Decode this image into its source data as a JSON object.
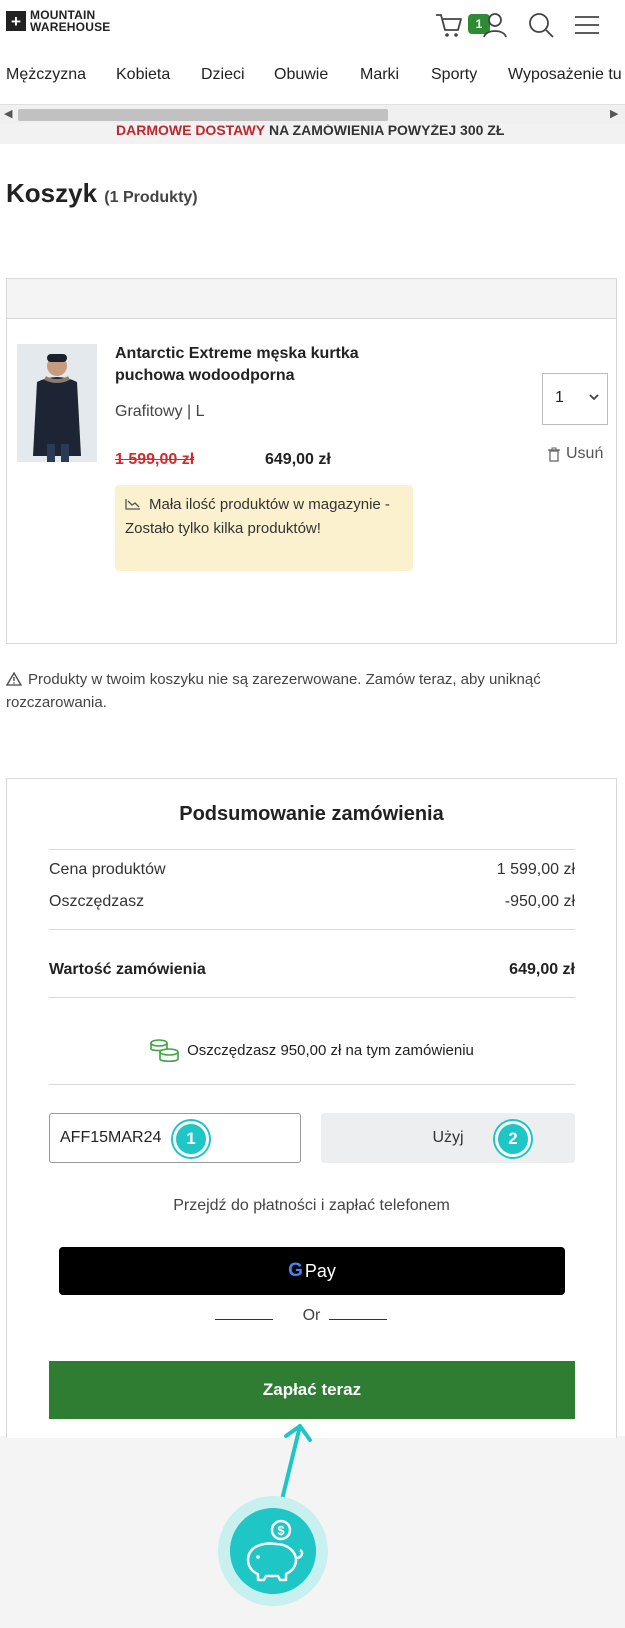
{
  "brand": {
    "line1": "MOUNTAIN",
    "line2": "WAREHOUSE",
    "mark": "+"
  },
  "header": {
    "cart_count": "1"
  },
  "nav": {
    "items": [
      "Mężczyzna",
      "Kobieta",
      "Dzieci",
      "Obuwie",
      "Marki",
      "Sporty",
      "Wyposażenie tu"
    ]
  },
  "promo": {
    "text_red": "DARMOWE DOSTAWY",
    "text_dark": " NA ZAMÓWIENIA POWYŻEJ 300 ZŁ"
  },
  "page": {
    "title": "Koszyk",
    "count": "(1 Produkty)"
  },
  "basket": {
    "item": {
      "name": "Antarctic Extreme męska kurtka puchowa wodoodporna",
      "variant": "Grafitowy | L",
      "price_old": "1 599,00 zł",
      "price_new": "649,00 zł",
      "qty": "1",
      "remove": "Usuń",
      "stock_note": "Mała ilość produktów w magazynie - Zostało tylko kilka produktów!"
    }
  },
  "warning": "Produkty w twoim koszyku nie są zarezerwowane. Zamów teraz, aby uniknąć rozczarowania.",
  "summary": {
    "title": "Podsumowanie zamówienia",
    "rows": [
      {
        "label": "Cena produktów",
        "value": "1 599,00 zł"
      },
      {
        "label": "Oszczędzasz",
        "value": "-950,00 zł"
      }
    ],
    "total_label": "Wartość zamówienia",
    "total_value": "649,00 zł",
    "saving_text": "Oszczędzasz 950,00 zł na tym zamówieniu",
    "code_value": "AFF15MAR24",
    "apply_label": "Użyj",
    "mobile_pay_text": "Przejdź do płatności i zapłać telefonem",
    "gpay_g": "G",
    "gpay_label": "Pay",
    "or_label": "Or",
    "pay_label": "Zapłać teraz"
  },
  "markers": {
    "one": "1",
    "two": "2",
    "piggy_symbol": "$"
  },
  "colors": {
    "accent": "#2e7d32",
    "badge": "#2e8b34",
    "sale": "#d6282e",
    "marker": "#1ec6c6",
    "stock_bg": "#fcf1cf"
  }
}
